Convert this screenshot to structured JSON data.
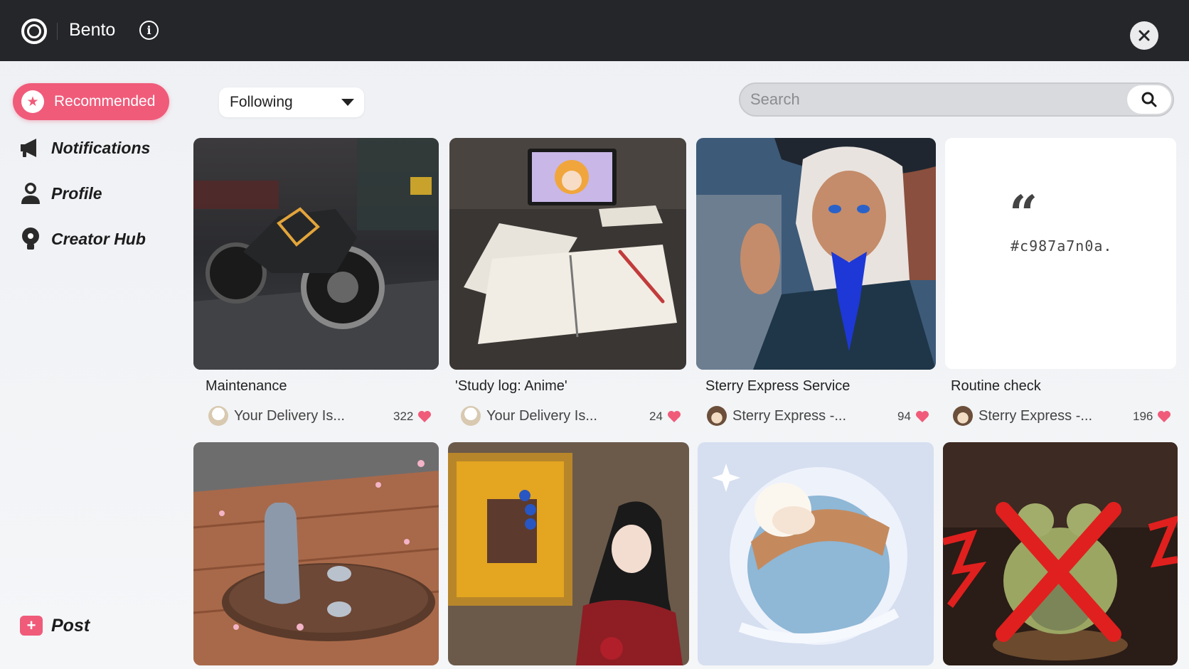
{
  "app": {
    "title": "Bento"
  },
  "sidebar": {
    "recommended_label": "Recommended",
    "items": [
      {
        "label": "Notifications",
        "icon": "megaphone-icon"
      },
      {
        "label": "Profile",
        "icon": "person-icon"
      },
      {
        "label": "Creator Hub",
        "icon": "lightbulb-icon"
      }
    ],
    "post_label": "Post"
  },
  "filter": {
    "selected": "Following"
  },
  "search": {
    "placeholder": "Search"
  },
  "colors": {
    "accent": "#f05b7a",
    "topbar": "#25262a"
  },
  "cards": [
    {
      "title": "Maintenance",
      "author": "Your Delivery Is...",
      "likes": "322"
    },
    {
      "title": "'Study log: Anime'",
      "author": "Your Delivery Is...",
      "likes": "24"
    },
    {
      "title": "Sterry Express Service",
      "author": "Sterry Express -...",
      "likes": "94"
    },
    {
      "title": "Routine check",
      "author": "Sterry Express -...",
      "likes": "196",
      "quote_text": "#c987a7n0a."
    }
  ]
}
